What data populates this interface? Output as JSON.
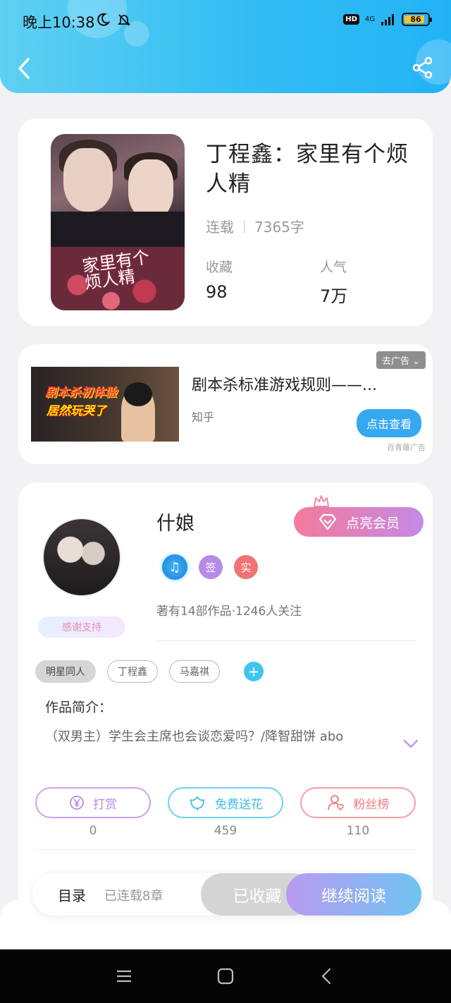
{
  "status_bar": {
    "time": "晚上10:38",
    "hd": "HD",
    "network": "4G",
    "battery": "86"
  },
  "book": {
    "title": "丁程鑫：家里有个烦人精",
    "cover_text": "家里有个烦人精",
    "status": "连载",
    "word_count": "7365字",
    "collect_label": "收藏",
    "collect_value": "98",
    "popularity_label": "人气",
    "popularity_value": "7万"
  },
  "ad": {
    "dismiss_label": "去广告",
    "thumb_line1": "剧本杀初体验",
    "thumb_line2": "居然玩哭了",
    "title": "剧本杀标准游戏规则——...",
    "source": "知乎",
    "cta": "点击查看",
    "brand": "百青藤广告"
  },
  "author": {
    "name": "什娘",
    "vip_button": "点亮会员",
    "badge_sign": "签",
    "badge_real": "实",
    "meta": "著有14部作品·1246人关注",
    "thanks": "感谢支持"
  },
  "tags": [
    "明星同人",
    "丁程鑫",
    "马嘉祺"
  ],
  "intro": {
    "label": "作品简介：",
    "text": "（双男主）学生会主席也会谈恋爱吗？/降智甜饼 abo"
  },
  "actions": {
    "reward_label": "打赏",
    "reward_count": "0",
    "flower_label": "免费送花",
    "flower_count": "459",
    "fans_label": "粉丝榜",
    "fans_count": "110"
  },
  "bottom_bar": {
    "toc": "目录",
    "chapters": "已连载8章",
    "collected": "已收藏",
    "continue": "继续阅读"
  },
  "colors": {
    "header_gradient_start": "#5ed0f2",
    "header_gradient_end": "#22b3f6",
    "accent_blue": "#36a8f0",
    "vip_pink": "#f47a9a"
  }
}
